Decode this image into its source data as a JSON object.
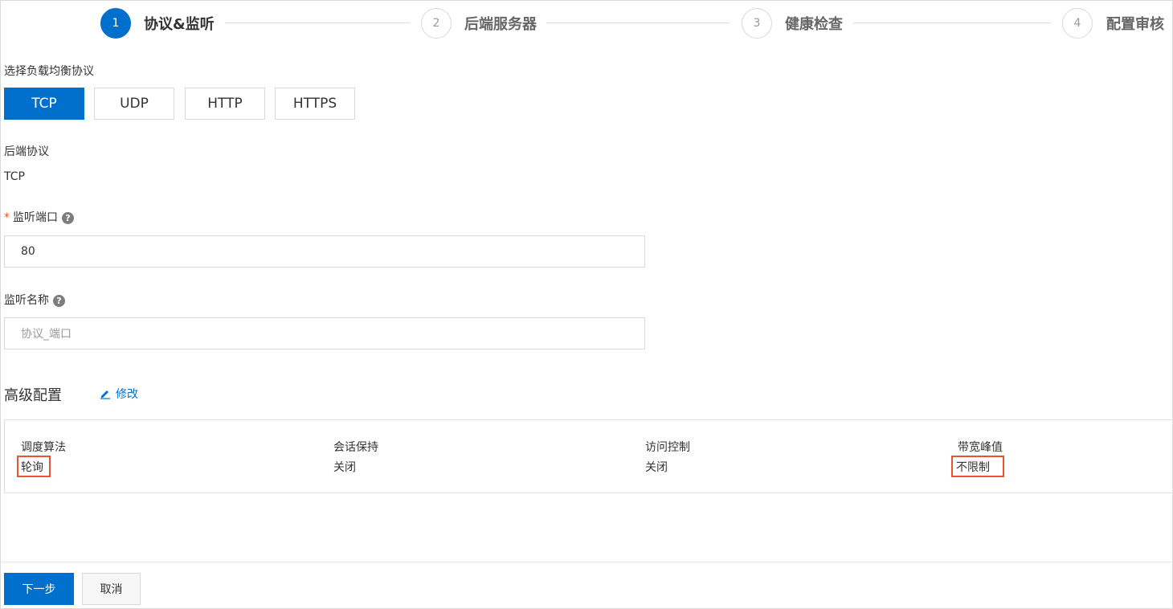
{
  "steps": [
    {
      "number": "1",
      "label": "协议&监听",
      "active": true
    },
    {
      "number": "2",
      "label": "后端服务器",
      "active": false
    },
    {
      "number": "3",
      "label": "健康检查",
      "active": false
    },
    {
      "number": "4",
      "label": "配置审核",
      "active": false
    }
  ],
  "protocol_section": {
    "label": "选择负载均衡协议",
    "options": [
      "TCP",
      "UDP",
      "HTTP",
      "HTTPS"
    ],
    "selected": "TCP"
  },
  "backend_protocol": {
    "label": "后端协议",
    "value": "TCP"
  },
  "listen_port": {
    "required_mark": "*",
    "label": "监听端口",
    "value": "80"
  },
  "listen_name": {
    "label": "监听名称",
    "placeholder": "协议_端口"
  },
  "advanced": {
    "title": "高级配置",
    "edit_label": "修改",
    "items": [
      {
        "key": "调度算法",
        "value": "轮询",
        "highlighted": true
      },
      {
        "key": "会话保持",
        "value": "关闭",
        "highlighted": false
      },
      {
        "key": "访问控制",
        "value": "关闭",
        "highlighted": false
      },
      {
        "key": "带宽峰值",
        "value": "不限制",
        "highlighted": true
      }
    ]
  },
  "footer": {
    "next_label": "下一步",
    "cancel_label": "取消"
  },
  "colors": {
    "primary": "#0070cc",
    "highlight": "#e8542f"
  },
  "icons": {
    "help": "question-circle-icon",
    "edit": "pencil-icon"
  }
}
